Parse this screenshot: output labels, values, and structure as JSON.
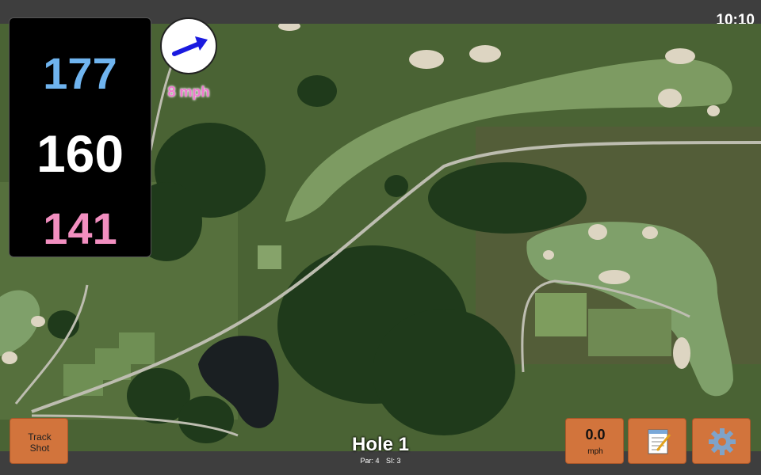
{
  "status": {
    "time": "10:10"
  },
  "distances": {
    "back": "177",
    "middle": "160",
    "front": "141"
  },
  "wind": {
    "speed_label": "8 mph",
    "icon": "arrow-icon",
    "color": "#1a1adf"
  },
  "hole": {
    "title": "Hole 1",
    "par": "Par: 4",
    "si": "SI: 3"
  },
  "buttons": {
    "track_line1": "Track",
    "track_line2": "Shot",
    "speed_value": "0.0",
    "speed_unit": "mph",
    "notes_icon": "notepad-icon",
    "settings_icon": "gear-icon"
  },
  "colors": {
    "button": "#d2743c",
    "back": "#6fb4ef",
    "front": "#f28fc0",
    "wind_text": "#f07ad0"
  }
}
